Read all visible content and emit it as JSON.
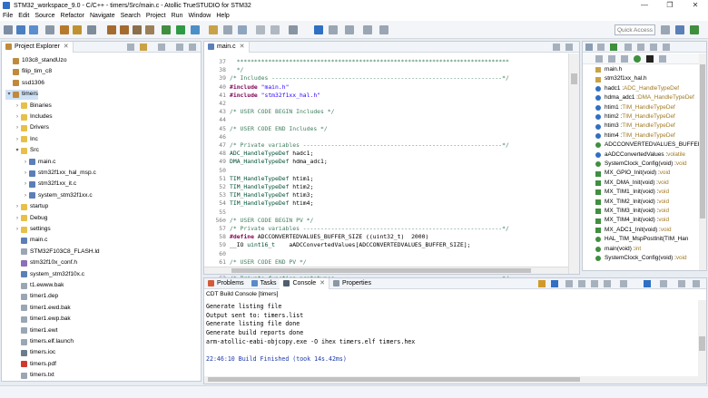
{
  "window": {
    "title": "STM32_workspace_9.0 - C/C++ - timers/Src/main.c - Atollic TrueSTUDIO for STM32",
    "minimize": "—",
    "maximize": "❐",
    "close": "✕"
  },
  "menu": [
    "File",
    "Edit",
    "Source",
    "Refactor",
    "Navigate",
    "Search",
    "Project",
    "Run",
    "Window",
    "Help"
  ],
  "toolbar": {
    "quick_access_placeholder": "Quick Access"
  },
  "explorer": {
    "tab": "Project Explorer",
    "close": "✕",
    "items": [
      {
        "label": "103c8_standUzo",
        "chev": "",
        "type": "project"
      },
      {
        "label": "filip_tim_c8",
        "chev": "",
        "type": "project"
      },
      {
        "label": "ssd1306",
        "chev": "",
        "type": "project"
      },
      {
        "label": "timers",
        "chev": "▾",
        "type": "project"
      },
      {
        "label": "Binaries",
        "chev": "›",
        "type": "folder"
      },
      {
        "label": "Includes",
        "chev": "›",
        "type": "folder"
      },
      {
        "label": "Drivers",
        "chev": "›",
        "type": "folder"
      },
      {
        "label": "Inc",
        "chev": "›",
        "type": "folder"
      },
      {
        "label": "Src",
        "chev": "▾",
        "type": "folder"
      },
      {
        "label": "main.c",
        "chev": "›",
        "type": "cfile"
      },
      {
        "label": "stm32f1xx_hal_msp.c",
        "chev": "›",
        "type": "cfile"
      },
      {
        "label": "stm32f1xx_it.c",
        "chev": "›",
        "type": "cfile"
      },
      {
        "label": "system_stm32f1xx.c",
        "chev": "›",
        "type": "cfile"
      },
      {
        "label": "startup",
        "chev": "›",
        "type": "folder"
      },
      {
        "label": "Debug",
        "chev": "›",
        "type": "folder"
      },
      {
        "label": "settings",
        "chev": "›",
        "type": "folder"
      },
      {
        "label": "main.c",
        "chev": "",
        "type": "cfile"
      },
      {
        "label": "STM32F103C8_FLASH.ld",
        "chev": "",
        "type": "gen"
      },
      {
        "label": "stm32f10x_conf.h",
        "chev": "",
        "type": "hfile"
      },
      {
        "label": "system_stm32f10x.c",
        "chev": "",
        "type": "cfile"
      },
      {
        "label": "t1.ewww.bak",
        "chev": "",
        "type": "gen"
      },
      {
        "label": "timer1.dep",
        "chev": "",
        "type": "gen"
      },
      {
        "label": "timer1.ewd.bak",
        "chev": "",
        "type": "gen"
      },
      {
        "label": "timer1.ewp.bak",
        "chev": "",
        "type": "gen"
      },
      {
        "label": "timer1.ewt",
        "chev": "",
        "type": "gen"
      },
      {
        "label": "timers.elf.launch",
        "chev": "",
        "type": "gen"
      },
      {
        "label": "timers.ioc",
        "chev": "",
        "type": "bin"
      },
      {
        "label": "timers.pdf",
        "chev": "",
        "type": "pdf"
      },
      {
        "label": "timers.txt",
        "chev": "",
        "type": "gen"
      }
    ]
  },
  "editor": {
    "tab": "main.c",
    "close": "✕",
    "lines": [
      {
        "n": "37",
        "segs": [
          {
            "t": "  ******************************************************************************",
            "c": "c-comment"
          }
        ]
      },
      {
        "n": "38",
        "segs": [
          {
            "t": "  */",
            "c": "c-comment"
          }
        ]
      },
      {
        "n": "39",
        "segs": [
          {
            "t": "/* Includes ------------------------------------------------------------------*/",
            "c": "c-comment"
          }
        ]
      },
      {
        "n": "40",
        "segs": [
          {
            "t": "#include ",
            "c": "c-pre"
          },
          {
            "t": "\"main.h\"",
            "c": "c-str"
          }
        ]
      },
      {
        "n": "41",
        "segs": [
          {
            "t": "#include ",
            "c": "c-pre"
          },
          {
            "t": "\"stm32f1xx_hal.h\"",
            "c": "c-str"
          }
        ]
      },
      {
        "n": "42",
        "segs": [
          {
            "t": "",
            "c": ""
          }
        ]
      },
      {
        "n": "43",
        "segs": [
          {
            "t": "/* USER CODE BEGIN Includes */",
            "c": "c-comment"
          }
        ]
      },
      {
        "n": "44",
        "segs": [
          {
            "t": "",
            "c": ""
          }
        ]
      },
      {
        "n": "45",
        "segs": [
          {
            "t": "/* USER CODE END Includes */",
            "c": "c-comment"
          }
        ]
      },
      {
        "n": "46",
        "segs": [
          {
            "t": "",
            "c": ""
          }
        ]
      },
      {
        "n": "47",
        "segs": [
          {
            "t": "/* Private variables ---------------------------------------------------------*/",
            "c": "c-comment"
          }
        ]
      },
      {
        "n": "48",
        "segs": [
          {
            "t": "ADC_HandleTypeDef",
            "c": "c-type"
          },
          {
            "t": " hadc1;",
            "c": "c-ident"
          }
        ]
      },
      {
        "n": "49",
        "segs": [
          {
            "t": "DMA_HandleTypeDef",
            "c": "c-type"
          },
          {
            "t": " hdma_adc1;",
            "c": "c-ident"
          }
        ]
      },
      {
        "n": "50",
        "segs": [
          {
            "t": "",
            "c": ""
          }
        ]
      },
      {
        "n": "51",
        "segs": [
          {
            "t": "TIM_HandleTypeDef",
            "c": "c-type"
          },
          {
            "t": " htim1;",
            "c": "c-ident"
          }
        ]
      },
      {
        "n": "52",
        "segs": [
          {
            "t": "TIM_HandleTypeDef",
            "c": "c-type"
          },
          {
            "t": " htim2;",
            "c": "c-ident"
          }
        ]
      },
      {
        "n": "53",
        "segs": [
          {
            "t": "TIM_HandleTypeDef",
            "c": "c-type"
          },
          {
            "t": " htim3;",
            "c": "c-ident"
          }
        ]
      },
      {
        "n": "54",
        "segs": [
          {
            "t": "TIM_HandleTypeDef",
            "c": "c-type"
          },
          {
            "t": " htim4;",
            "c": "c-ident"
          }
        ]
      },
      {
        "n": "55",
        "segs": [
          {
            "t": "",
            "c": ""
          }
        ]
      },
      {
        "n": "56⊖",
        "segs": [
          {
            "t": "/* USER CODE BEGIN PV */",
            "c": "c-comment"
          }
        ]
      },
      {
        "n": "57",
        "segs": [
          {
            "t": "/* Private variables ---------------------------------------------------------*/",
            "c": "c-comment"
          }
        ]
      },
      {
        "n": "58",
        "segs": [
          {
            "t": "#define ",
            "c": "c-pre"
          },
          {
            "t": "ADCCONVERTEDVALUES_BUFFER_SIZE ((uint32_t)  2000)",
            "c": "c-ident"
          }
        ]
      },
      {
        "n": "59",
        "segs": [
          {
            "t": "__IO ",
            "c": "c-ident"
          },
          {
            "t": "uint16_t",
            "c": "c-type"
          },
          {
            "t": "    aADCConvertedValues[ADCCONVERTEDVALUES_BUFFER_SIZE];",
            "c": "c-ident"
          }
        ]
      },
      {
        "n": "60",
        "segs": [
          {
            "t": "",
            "c": ""
          }
        ]
      },
      {
        "n": "61",
        "segs": [
          {
            "t": "/* USER CODE END PV */",
            "c": "c-comment"
          }
        ]
      },
      {
        "n": "62",
        "segs": [
          {
            "t": "",
            "c": ""
          }
        ]
      },
      {
        "n": "63",
        "segs": [
          {
            "t": "/* Private function prototypes -----------------------------------------------*/",
            "c": "c-comment"
          }
        ]
      }
    ]
  },
  "outline": {
    "items": [
      {
        "label": "main.h",
        "type": "",
        "icon": "include"
      },
      {
        "label": "stm32f1xx_hal.h",
        "type": "",
        "icon": "include"
      },
      {
        "label": "hadc1 : ",
        "type": "ADC_HandleTypeDef",
        "icon": "var"
      },
      {
        "label": "hdma_adc1 : ",
        "type": "DMA_HandleTypeDef",
        "icon": "var"
      },
      {
        "label": "htim1 : ",
        "type": "TIM_HandleTypeDef",
        "icon": "var"
      },
      {
        "label": "htim2 : ",
        "type": "TIM_HandleTypeDef",
        "icon": "var"
      },
      {
        "label": "htim3 : ",
        "type": "TIM_HandleTypeDef",
        "icon": "var"
      },
      {
        "label": "htim4 : ",
        "type": "TIM_HandleTypeDef",
        "icon": "var"
      },
      {
        "label": "ADCCONVERTEDVALUES_BUFFER",
        "type": "",
        "icon": "macro"
      },
      {
        "label": "aADCConvertedValues : ",
        "type": "volatile",
        "icon": "var"
      },
      {
        "label": "SystemClock_Config(void) : ",
        "type": "void",
        "icon": "func"
      },
      {
        "label": "MX_GPIO_Init(void) : ",
        "type": "void",
        "icon": "sfunc"
      },
      {
        "label": "MX_DMA_Init(void) : ",
        "type": "void",
        "icon": "sfunc"
      },
      {
        "label": "MX_TIM1_Init(void) : ",
        "type": "void",
        "icon": "sfunc"
      },
      {
        "label": "MX_TIM2_Init(void) : ",
        "type": "void",
        "icon": "sfunc"
      },
      {
        "label": "MX_TIM3_Init(void) : ",
        "type": "void",
        "icon": "sfunc"
      },
      {
        "label": "MX_TIM4_Init(void) : ",
        "type": "void",
        "icon": "sfunc"
      },
      {
        "label": "MX_ADC1_Init(void) : ",
        "type": "void",
        "icon": "sfunc"
      },
      {
        "label": "HAL_TIM_MspPostInit(TIM_Han",
        "type": "",
        "icon": "func"
      },
      {
        "label": "main(void) : ",
        "type": "int",
        "icon": "func"
      },
      {
        "label": "SystemClock_Config(void) : ",
        "type": "void",
        "icon": "func"
      }
    ]
  },
  "console": {
    "tabs": [
      "Problems",
      "Tasks",
      "Console",
      "Properties"
    ],
    "active_tab_close": "✕",
    "title": "CDT Build Console [timers]",
    "lines": [
      {
        "t": "Generate listing file",
        "blue": false
      },
      {
        "t": "Output sent to: timers.list",
        "blue": false
      },
      {
        "t": "Generate listing file done",
        "blue": false
      },
      {
        "t": "Generate build reports done",
        "blue": false
      },
      {
        "t": "arm-atollic-eabi-objcopy.exe -O ihex timers.elf timers.hex",
        "blue": false
      },
      {
        "t": "",
        "blue": false
      },
      {
        "t": "22:46:10 Build Finished (took 14s.42ms)",
        "blue": true
      }
    ]
  },
  "colors": {
    "accent": "#2f6fc4",
    "comment": "#3f7f5f",
    "keyword": "#7f0055",
    "string": "#2a00ff"
  }
}
